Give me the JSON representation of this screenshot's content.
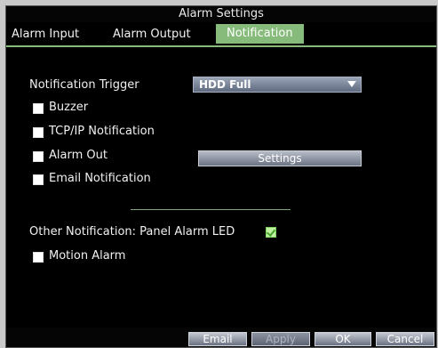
{
  "window": {
    "title": "Alarm Settings"
  },
  "tabs": [
    {
      "label": "Alarm Input",
      "active": false
    },
    {
      "label": "Alarm Output",
      "active": false
    },
    {
      "label": "Notification",
      "active": true
    }
  ],
  "notification": {
    "trigger_label": "Notification Trigger",
    "trigger_value": "HDD Full",
    "buzzer_label": "Buzzer",
    "tcpip_label": "TCP/IP Notification",
    "alarm_out_label": "Alarm Out",
    "settings_button": "Settings",
    "email_label": "Email Notification",
    "other_label": "Other Notification: Panel Alarm LED",
    "motion_label": "Motion Alarm"
  },
  "bottom": {
    "email": "Email",
    "apply": "Apply",
    "ok": "OK",
    "cancel": "Cancel"
  },
  "colors": {
    "accent": "#86bb7b",
    "background": "#000000",
    "chrome": "#c9c9c9"
  }
}
